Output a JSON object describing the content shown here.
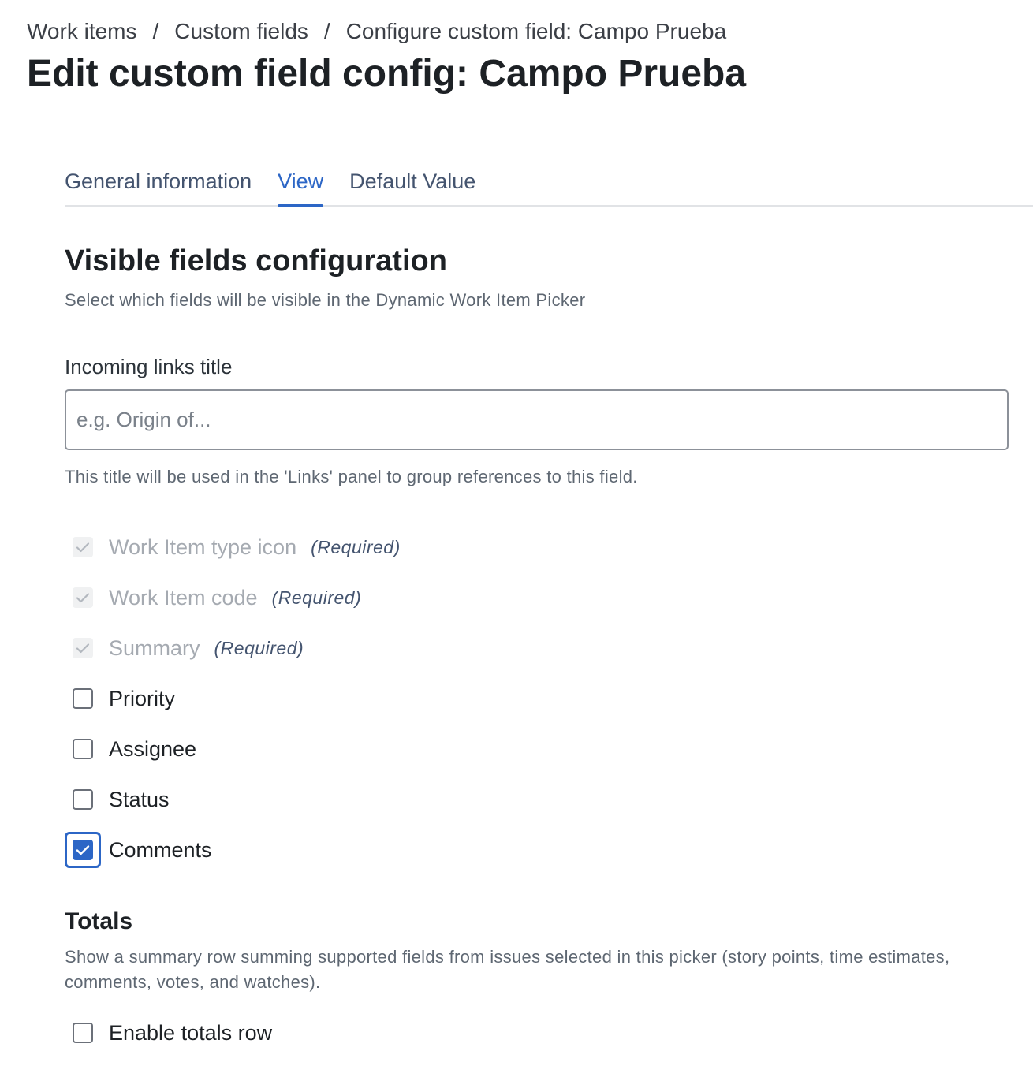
{
  "breadcrumb": {
    "items": [
      "Work items",
      "Custom fields",
      "Configure custom field: Campo Prueba"
    ],
    "separator": "/"
  },
  "page_title": "Edit custom field config: Campo Prueba",
  "tabs": [
    {
      "label": "General information",
      "active": false
    },
    {
      "label": "View",
      "active": true
    },
    {
      "label": "Default Value",
      "active": false
    }
  ],
  "visible_fields": {
    "title": "Visible fields configuration",
    "description": "Select which fields will be visible in the Dynamic Work Item Picker"
  },
  "incoming_links": {
    "label": "Incoming links title",
    "value": "",
    "placeholder": "e.g. Origin of...",
    "helper": "This title will be used in the 'Links' panel to group references to this field."
  },
  "fields": [
    {
      "label": "Work Item type icon",
      "checked": true,
      "disabled": true,
      "note": "(Required)"
    },
    {
      "label": "Work Item code",
      "checked": true,
      "disabled": true,
      "note": "(Required)"
    },
    {
      "label": "Summary",
      "checked": true,
      "disabled": true,
      "note": "(Required)"
    },
    {
      "label": "Priority",
      "checked": false,
      "disabled": false
    },
    {
      "label": "Assignee",
      "checked": false,
      "disabled": false
    },
    {
      "label": "Status",
      "checked": false,
      "disabled": false
    },
    {
      "label": "Comments",
      "checked": true,
      "disabled": false,
      "focused": true
    }
  ],
  "totals": {
    "title": "Totals",
    "description": "Show a summary row summing supported fields from issues selected in this picker (story points, time estimates, comments, votes, and watches).",
    "enable_label": "Enable totals row",
    "enabled": false
  },
  "colors": {
    "accent": "#2c66c6",
    "text": "#1d2125",
    "muted": "#5e6772",
    "disabled_text": "#a5aab1"
  }
}
